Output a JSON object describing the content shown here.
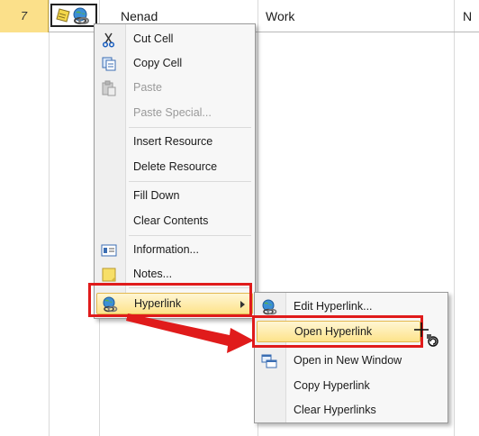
{
  "sheet": {
    "row_number": "7",
    "name_cell": "Nenad",
    "type_cell": "Work",
    "next_cell": "N"
  },
  "context_menu": {
    "items": [
      {
        "label": "Cut Cell",
        "icon": "scissors-icon"
      },
      {
        "label": "Copy Cell",
        "icon": "copy-icon"
      },
      {
        "label": "Paste",
        "icon": "paste-icon",
        "disabled": true
      },
      {
        "label": "Paste Special...",
        "disabled": true
      },
      {
        "label": "Insert Resource"
      },
      {
        "label": "Delete Resource"
      },
      {
        "label": "Fill Down"
      },
      {
        "label": "Clear Contents"
      },
      {
        "label": "Information...",
        "icon": "info-card-icon"
      },
      {
        "label": "Notes...",
        "icon": "note-icon"
      },
      {
        "label": "Hyperlink",
        "icon": "hyperlink-globe-icon",
        "has_submenu": true
      }
    ]
  },
  "submenu": {
    "items": [
      {
        "label": "Edit Hyperlink...",
        "icon": "hyperlink-globe-icon"
      },
      {
        "label": "Open Hyperlink"
      },
      {
        "label": "Open in New Window",
        "icon": "new-window-icon"
      },
      {
        "label": "Copy Hyperlink"
      },
      {
        "label": "Clear Hyperlinks"
      }
    ]
  },
  "colors": {
    "highlight": "#fde38a",
    "annotation": "#e01b1b",
    "row_header": "#fbe08a"
  }
}
